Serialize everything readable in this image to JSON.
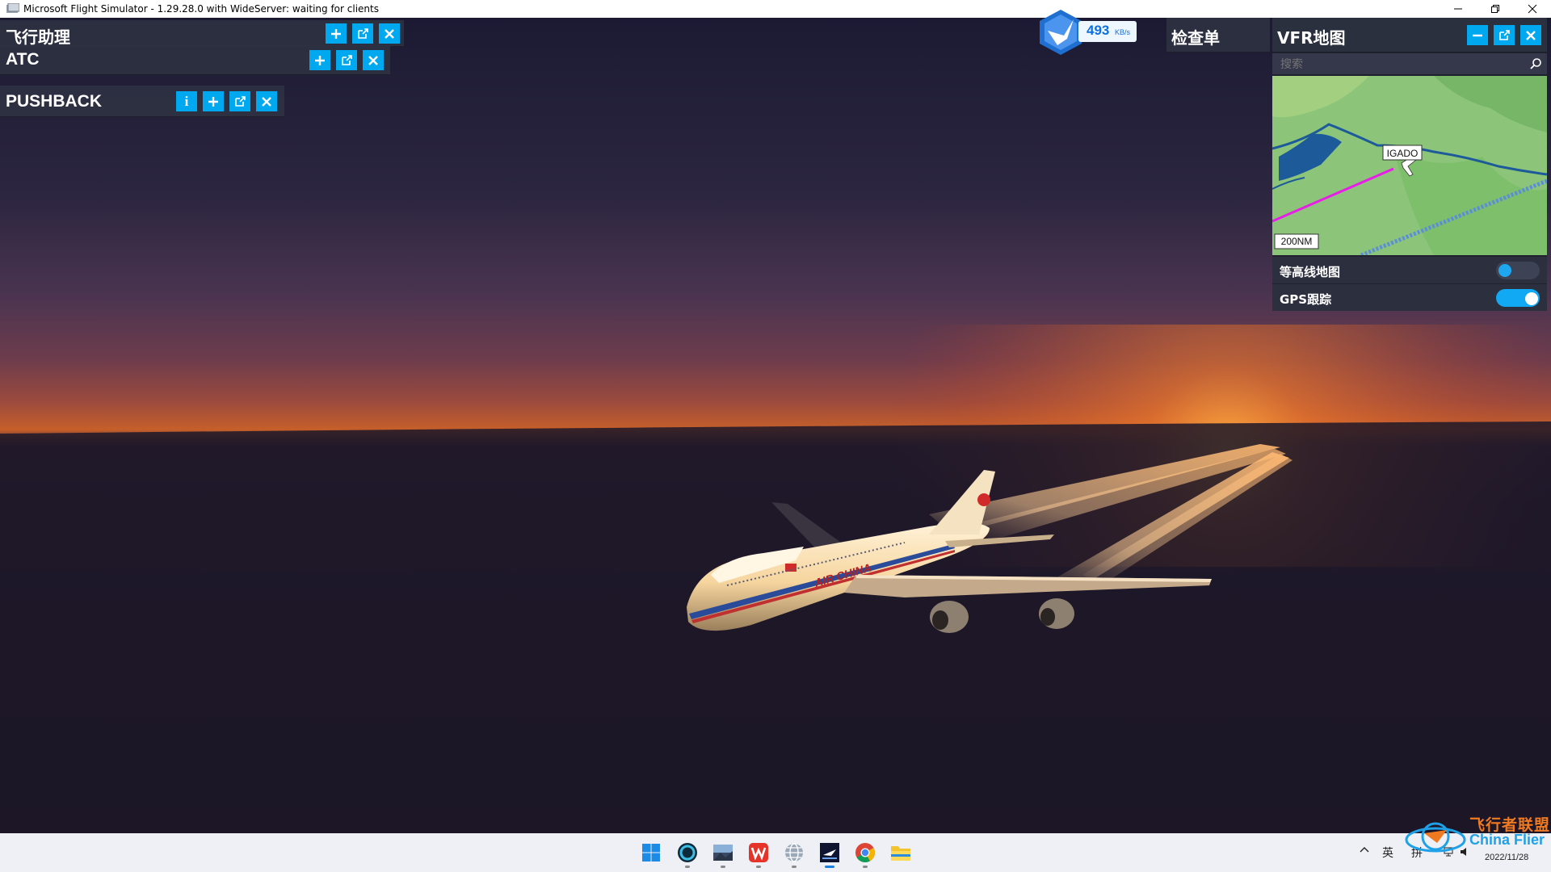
{
  "window": {
    "title": "Microsoft Flight Simulator - 1.29.28.0 with WideServer: waiting for clients"
  },
  "panels": {
    "flight_assist": {
      "title": "飞行助理"
    },
    "atc": {
      "title": "ATC"
    },
    "pushback": {
      "title": "PUSHBACK",
      "info_label": "i"
    },
    "checklist": {
      "title": "检查单"
    }
  },
  "vfr_map": {
    "title": "VFR地图",
    "search_placeholder": "搜索",
    "waypoint": "IGADO",
    "scale": "200NM",
    "toggles": [
      {
        "label": "等高线地图",
        "on": false
      },
      {
        "label": "GPS跟踪",
        "on": true
      }
    ]
  },
  "network": {
    "value": "493",
    "unit": "KB/s"
  },
  "aircraft": {
    "livery_text": "AIR CHINA"
  },
  "taskbar": {
    "icons": [
      "windows-start-icon",
      "cortana-icon",
      "photo-app-icon",
      "wps-icon",
      "globe-icon",
      "msfs-icon",
      "chrome-icon",
      "file-explorer-icon"
    ],
    "tray": {
      "ime_lang": "英",
      "ime_mode": "拼"
    },
    "date": "2022/11/28"
  },
  "watermark": {
    "cn": "飞行者联盟",
    "en": "China Flier"
  },
  "colors": {
    "accent": "#00a8f0",
    "panel_bg": "#2e3242",
    "route": "#e81ee8"
  }
}
